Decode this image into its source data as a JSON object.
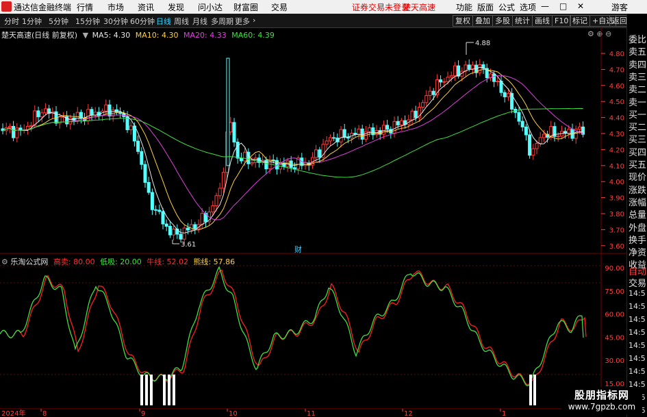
{
  "menu": {
    "app_title": "通达信金融终端",
    "items": [
      "行情",
      "市场",
      "资讯",
      "发现",
      "问小达",
      "财富圈",
      "交易"
    ],
    "notice": "证券交易未登录",
    "stock": "楚天高速",
    "right_items": [
      "功能",
      "版面",
      "公式",
      "选项"
    ],
    "guest": "游客"
  },
  "toolbar": {
    "periods": [
      "分时",
      "1分钟",
      "5分钟",
      "15分钟",
      "30分钟",
      "60分钟",
      "日线",
      "周线",
      "月线",
      "多周期",
      "更多"
    ],
    "active": "日线",
    "right_buttons": [
      "复权",
      "叠加",
      "多股",
      "统计",
      "画线",
      "F10",
      "标记",
      "+自选",
      "返回"
    ]
  },
  "main_legend": {
    "title": "楚天高速(日线 前复权)",
    "ma": [
      {
        "label": "MA5: 4.30",
        "color": "#e8e8e8"
      },
      {
        "label": "MA10: 4.30",
        "color": "#ffd23c"
      },
      {
        "label": "MA20: 4.33",
        "color": "#e040e0"
      },
      {
        "label": "MA60: 4.39",
        "color": "#40e040"
      }
    ]
  },
  "price_axis": [
    "4.80",
    "4.70",
    "4.60",
    "4.50",
    "4.40",
    "4.30",
    "4.20",
    "4.10",
    "4.00",
    "3.90",
    "3.80",
    "3.70",
    "3.60"
  ],
  "annotations": {
    "high": "4.88",
    "low": "3.61",
    "cai": "财"
  },
  "indicator_legend": {
    "name": "乐淘公式网",
    "items": [
      {
        "label": "高卖: 80.00",
        "color": "#ff3030"
      },
      {
        "label": "低吸: 20.00",
        "color": "#40e040"
      },
      {
        "label": "牛线: 52.02",
        "color": "#ff3030"
      },
      {
        "label": "熊线: 57.86",
        "color": "#ffd23c"
      }
    ]
  },
  "indicator_axis": [
    "90.00",
    "75.00",
    "60.00",
    "45.00",
    "30.00",
    "15.00"
  ],
  "date_axis": [
    "2024年",
    "8",
    "9",
    "10",
    "11",
    "12",
    "1"
  ],
  "right_panel": {
    "labels": [
      "委比",
      "卖五",
      "卖四",
      "卖三",
      "卖二",
      "卖一",
      "买一",
      "买二",
      "买三",
      "买四",
      "买五",
      "现价",
      "涨跌",
      "涨幅",
      "总量",
      "外盘",
      "换手",
      "净资",
      "收益"
    ],
    "auto": "自动",
    "trade": "交易",
    "times": [
      "14:5",
      "14:5",
      "14:5",
      "14:5",
      "14:5",
      "14:5",
      "14:5",
      "14:5",
      "14:5",
      "14:5"
    ]
  },
  "watermark": {
    "title": "股朋指标网",
    "url": "www.7gpzb.com"
  },
  "colors": {
    "up": "#ff3c3c",
    "down": "#54ffff",
    "ma5": "#e8e8e8",
    "ma10": "#ffd23c",
    "ma20": "#e040e0",
    "ma60": "#40e040"
  }
}
